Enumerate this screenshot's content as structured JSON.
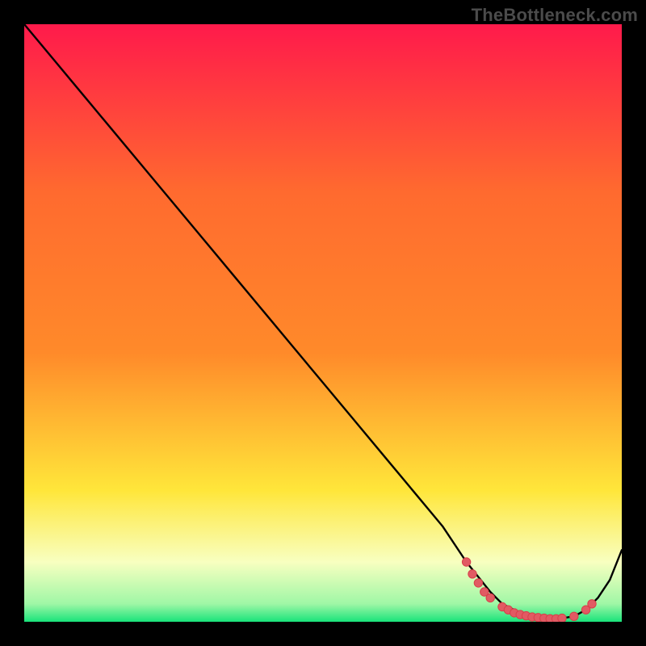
{
  "watermark": "TheBottleneck.com",
  "colors": {
    "background": "#000000",
    "gradient_top": "#ff1a4b",
    "gradient_mid1": "#ff8a2a",
    "gradient_mid2": "#ffe63a",
    "gradient_bottom_light": "#f8ffc0",
    "gradient_bottom": "#19e37a",
    "curve": "#000000",
    "marker_fill": "#e15a63",
    "marker_stroke": "#d83f4a"
  },
  "chart_data": {
    "type": "line",
    "title": "",
    "xlabel": "",
    "ylabel": "",
    "xlim": [
      0,
      100
    ],
    "ylim": [
      0,
      100
    ],
    "grid": false,
    "legend": false,
    "series": [
      {
        "name": "bottleneck-curve",
        "x": [
          0,
          5,
          10,
          15,
          20,
          25,
          30,
          35,
          40,
          45,
          50,
          55,
          60,
          65,
          70,
          74,
          78,
          80,
          82,
          84,
          86,
          88,
          90,
          92,
          94,
          96,
          98,
          100
        ],
        "y": [
          100,
          94,
          88,
          82,
          76,
          70,
          64,
          58,
          52,
          46,
          40,
          34,
          28,
          22,
          16,
          10,
          5,
          3,
          2,
          1,
          0.7,
          0.5,
          0.6,
          0.9,
          2,
          4,
          7,
          12
        ]
      }
    ],
    "markers": [
      {
        "x": 74,
        "y": 10
      },
      {
        "x": 75,
        "y": 8
      },
      {
        "x": 76,
        "y": 6.5
      },
      {
        "x": 77,
        "y": 5
      },
      {
        "x": 78,
        "y": 4
      },
      {
        "x": 80,
        "y": 2.5
      },
      {
        "x": 81,
        "y": 2
      },
      {
        "x": 82,
        "y": 1.5
      },
      {
        "x": 83,
        "y": 1.2
      },
      {
        "x": 84,
        "y": 1
      },
      {
        "x": 85,
        "y": 0.8
      },
      {
        "x": 86,
        "y": 0.7
      },
      {
        "x": 87,
        "y": 0.6
      },
      {
        "x": 88,
        "y": 0.5
      },
      {
        "x": 89,
        "y": 0.5
      },
      {
        "x": 90,
        "y": 0.6
      },
      {
        "x": 92,
        "y": 0.9
      },
      {
        "x": 94,
        "y": 2
      },
      {
        "x": 95,
        "y": 3
      }
    ]
  }
}
